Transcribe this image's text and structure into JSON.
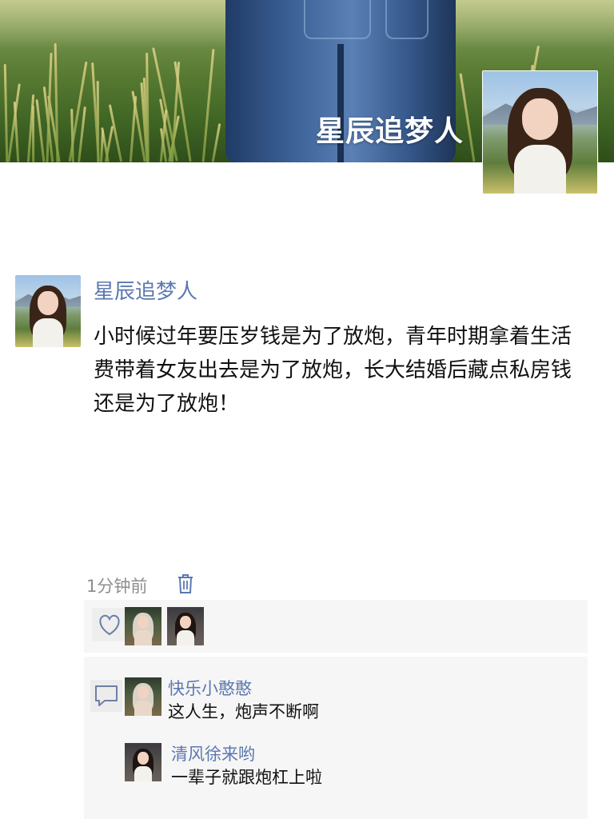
{
  "cover": {
    "title": "星辰追梦人"
  },
  "post": {
    "author": "星辰追梦人",
    "content": "小时候过年要压岁钱是为了放炮，青年时期拿着生活费带着女友出去是为了放炮，长大结婚后藏点私房钱还是为了放炮！",
    "time": "1分钟前"
  },
  "likes": {
    "icon": "heart-icon",
    "count": 2
  },
  "comments": [
    {
      "name": "快乐小憨憨",
      "text": "这人生，炮声不断啊"
    },
    {
      "name": "清风徐来哟",
      "text": "一辈子就跟炮杠上啦"
    }
  ],
  "colors": {
    "link": "#5b78b0",
    "meta": "#8e8e8e",
    "panel": "#f6f6f6"
  }
}
